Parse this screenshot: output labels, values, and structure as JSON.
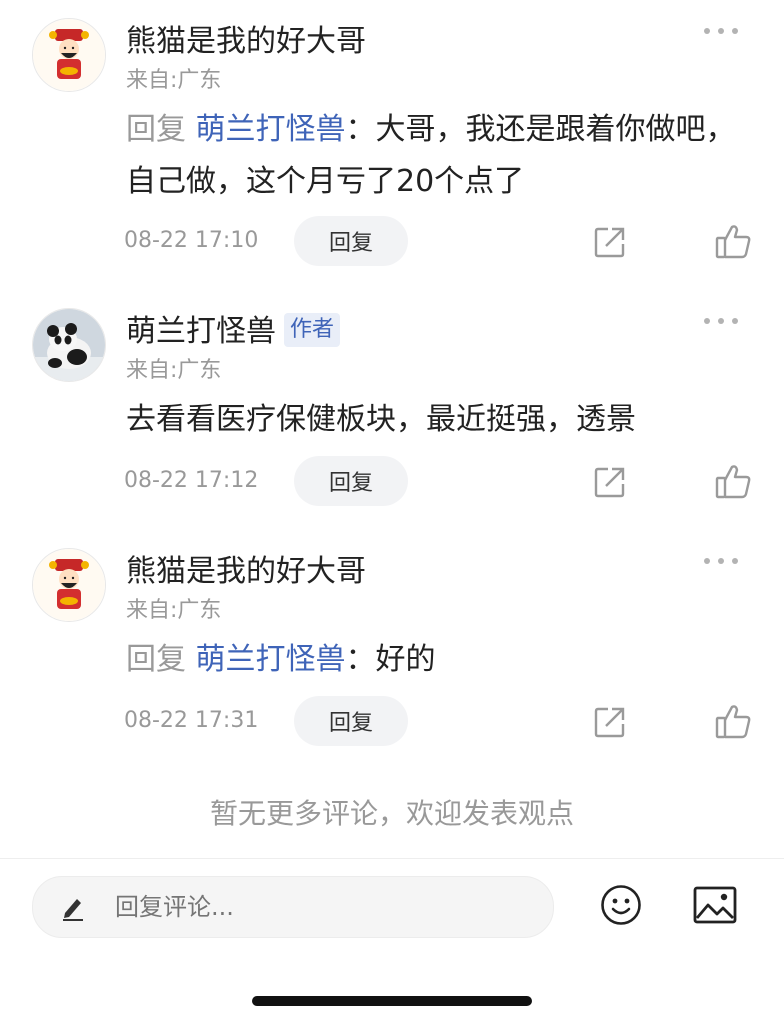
{
  "comments": [
    {
      "username": "熊猫是我的好大哥",
      "badge": "",
      "location": "来自:广东",
      "reply_prefix": "回复 ",
      "reply_target": "萌兰打怪兽",
      "reply_sep": "：",
      "text": "大哥，我还是跟着你做吧，自己做，这个月亏了20个点了",
      "time": "08-22 17:10",
      "reply_label": "回复",
      "avatar_icon": "fortune-god-avatar-icon"
    },
    {
      "username": "萌兰打怪兽",
      "badge": "作者",
      "location": "来自:广东",
      "reply_prefix": "",
      "reply_target": "",
      "reply_sep": "",
      "text": "去看看医疗保健板块，最近挺强，透景",
      "time": "08-22 17:12",
      "reply_label": "回复",
      "avatar_icon": "panda-avatar-icon"
    },
    {
      "username": "熊猫是我的好大哥",
      "badge": "",
      "location": "来自:广东",
      "reply_prefix": "回复 ",
      "reply_target": "萌兰打怪兽",
      "reply_sep": "：",
      "text": "好的",
      "time": "08-22 17:31",
      "reply_label": "回复",
      "avatar_icon": "fortune-god-avatar-icon"
    }
  ],
  "footer": {
    "no_more_text": "暂无更多评论，欢迎发表观点"
  },
  "input_bar": {
    "placeholder": "回复评论..."
  },
  "icons": {
    "more": "more-dots-icon",
    "share": "share-icon",
    "like": "thumbs-up-icon",
    "pencil": "pencil-icon",
    "emoji": "smiley-icon",
    "image": "image-icon"
  },
  "colors": {
    "link_blue": "#3f64b8",
    "muted_gray": "#999999",
    "button_bg": "#f2f3f5",
    "badge_bg": "#e9eef8"
  }
}
